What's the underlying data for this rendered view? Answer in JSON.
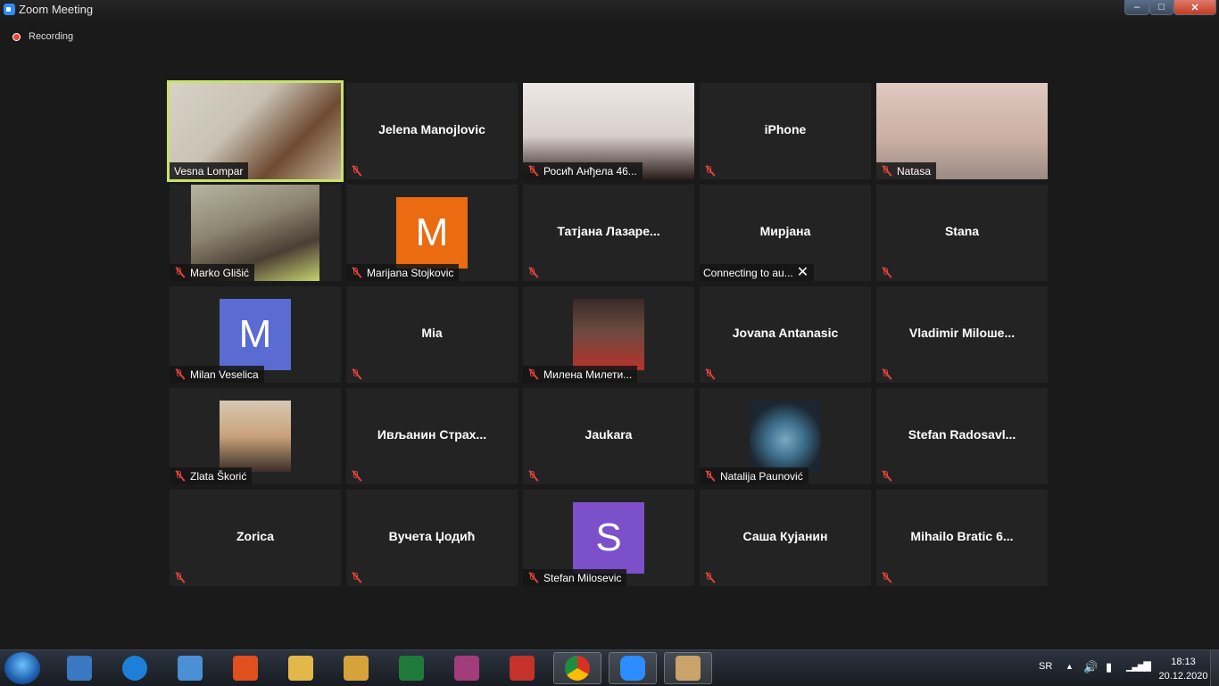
{
  "window": {
    "title": "Zoom Meeting",
    "close": "✕",
    "minimize": "–",
    "maximize": "□"
  },
  "recording": {
    "label": "Recording"
  },
  "participants": [
    {
      "name": "Vesna Lompar",
      "muted": false,
      "type": "video",
      "active": true
    },
    {
      "name": "Jelena Manojlovic",
      "muted": true,
      "type": "name"
    },
    {
      "name": "Росић Анђела 46...",
      "muted": true,
      "type": "video"
    },
    {
      "name": "iPhone",
      "muted": true,
      "type": "name"
    },
    {
      "name": "Natasa",
      "muted": true,
      "type": "video"
    },
    {
      "name": "Marko Glišić",
      "muted": true,
      "type": "video"
    },
    {
      "name": "Marijana Stojkovic",
      "muted": true,
      "type": "avatar",
      "initial": "M",
      "color": "#ea6b12"
    },
    {
      "name": "Татјана  Лазаре...",
      "muted": true,
      "type": "name"
    },
    {
      "name": "Мирјана",
      "muted": false,
      "type": "name",
      "status": "Connecting to au..."
    },
    {
      "name": "Stana",
      "muted": true,
      "type": "name"
    },
    {
      "name": "Milan Veselica",
      "muted": true,
      "type": "avatar",
      "initial": "M",
      "color": "#5a6bd2"
    },
    {
      "name": "Mia",
      "muted": true,
      "type": "name"
    },
    {
      "name": "Милена Милети...",
      "muted": true,
      "type": "photo"
    },
    {
      "name": "Jovana Antanasic",
      "muted": true,
      "type": "name"
    },
    {
      "name": "Vladimir  Milоше...",
      "muted": true,
      "type": "name"
    },
    {
      "name": "Zlata Škorić",
      "muted": true,
      "type": "photo"
    },
    {
      "name": "Ивљанин  Страх...",
      "muted": true,
      "type": "name"
    },
    {
      "name": "Jaukara",
      "muted": true,
      "type": "name"
    },
    {
      "name": "Natalija Paunović",
      "muted": true,
      "type": "photo"
    },
    {
      "name": "Stefan  Radosavl...",
      "muted": true,
      "type": "name"
    },
    {
      "name": "Zorica",
      "muted": true,
      "type": "name"
    },
    {
      "name": "Вучета Џодић",
      "muted": true,
      "type": "name"
    },
    {
      "name": "Stefan Milosevic",
      "muted": true,
      "type": "avatar",
      "initial": "S",
      "color": "#7b50c8"
    },
    {
      "name": "Саша Кујанин",
      "muted": true,
      "type": "name"
    },
    {
      "name": "Mihailo  Bratic  6...",
      "muted": true,
      "type": "name"
    }
  ],
  "taskbar": {
    "apps": [
      {
        "name": "media-player",
        "color": "#3a78c2"
      },
      {
        "name": "ie",
        "color": "#1e7fd8"
      },
      {
        "name": "video-app",
        "color": "#4b8fd6"
      },
      {
        "name": "pdf-reader",
        "color": "#e0501e"
      },
      {
        "name": "folder",
        "color": "#e3b84a"
      },
      {
        "name": "tool",
        "color": "#d6a23a"
      },
      {
        "name": "excel",
        "color": "#1f7a3a"
      },
      {
        "name": "winrar",
        "color": "#a33c7a"
      },
      {
        "name": "antivirus",
        "color": "#c4322a"
      },
      {
        "name": "chrome",
        "color": "#e2b42c"
      },
      {
        "name": "zoom",
        "color": "#2d8cff"
      },
      {
        "name": "paint",
        "color": "#c9a36a"
      }
    ],
    "lang": "SR",
    "time": "18:13",
    "date": "20.12.2020"
  }
}
